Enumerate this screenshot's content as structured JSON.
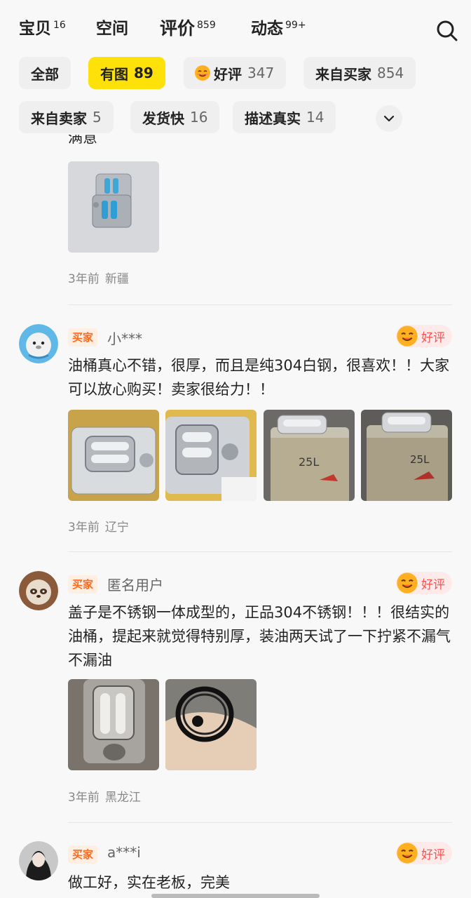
{
  "tabs": [
    {
      "label": "宝贝",
      "count": "16"
    },
    {
      "label": "空间",
      "count": ""
    },
    {
      "label": "评价",
      "count": "859"
    },
    {
      "label": "动态",
      "count": "99+"
    }
  ],
  "filters": [
    {
      "label": "全部",
      "count": ""
    },
    {
      "label": "有图",
      "count": "89"
    },
    {
      "label": "好评",
      "count": "347"
    },
    {
      "label": "来自买家",
      "count": "854"
    },
    {
      "label": "来自卖家",
      "count": "5"
    },
    {
      "label": "发货快",
      "count": "16"
    },
    {
      "label": "描述真实",
      "count": "14"
    }
  ],
  "reviews": [
    {
      "partial_text": "满意",
      "time": "3年前",
      "location": "新疆"
    },
    {
      "badge": "买家",
      "user": "小***",
      "rating": "好评",
      "text": "油桶真心不错，很厚，而且是纯304白钢，很喜欢！！大家可以放心购买！卖家很给力！！",
      "time": "3年前",
      "location": "辽宁"
    },
    {
      "badge": "买家",
      "user": "匿名用户",
      "rating": "好评",
      "text": "盖子是不锈钢一体成型的，正品304不锈钢！！！很结实的油桶，提起来就觉得特别厚，装油两天试了一下拧紧不漏气不漏油",
      "time": "3年前",
      "location": "黑龙江"
    },
    {
      "badge": "买家",
      "user": "a***i",
      "rating": "好评",
      "text": "做工好，实在老板，完美"
    }
  ],
  "photo_labels": {
    "can_25l_a": "25L",
    "can_25l_b": "25L"
  },
  "colors": {
    "accent_yellow": "#ffe10a",
    "badge_orange": "#ff6a1a",
    "good_red": "#ff4f4f"
  }
}
